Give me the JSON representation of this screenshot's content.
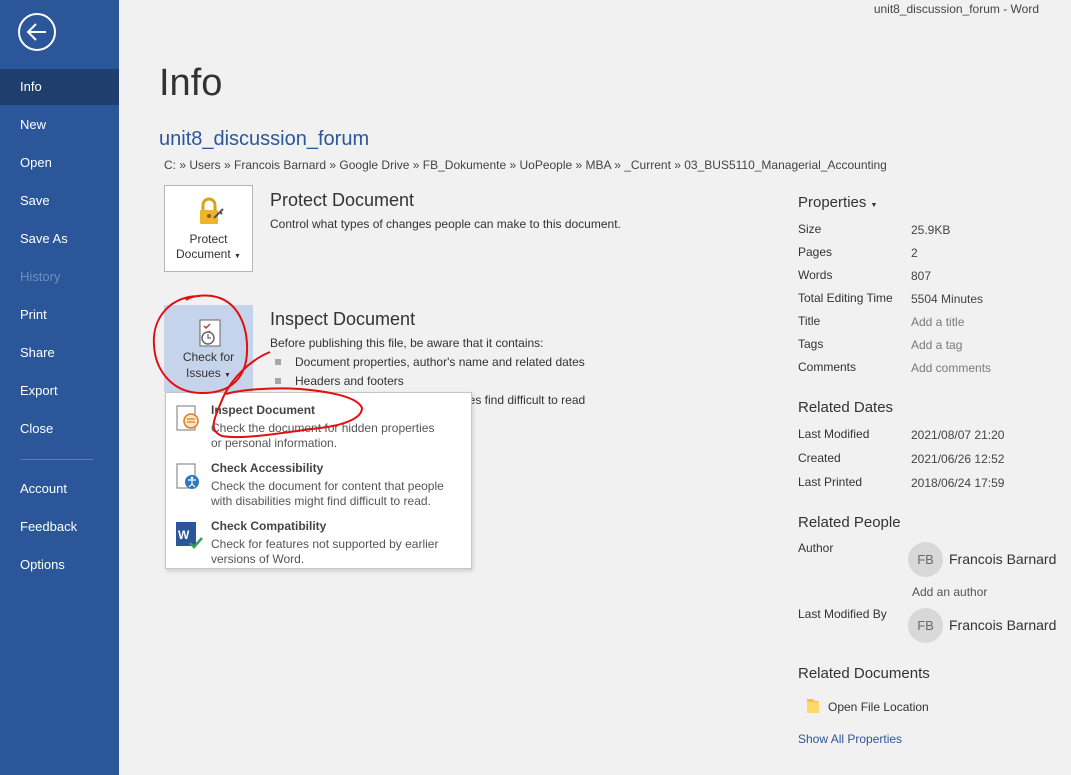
{
  "window": {
    "title": "unit8_discussion_forum  -  Word"
  },
  "sidebar": {
    "back_icon": "arrow-left-icon",
    "items": [
      {
        "label": "Info"
      },
      {
        "label": "New"
      },
      {
        "label": "Open"
      },
      {
        "label": "Save"
      },
      {
        "label": "Save As"
      },
      {
        "label": "History"
      },
      {
        "label": "Print"
      },
      {
        "label": "Share"
      },
      {
        "label": "Export"
      },
      {
        "label": "Close"
      },
      {
        "label": "Account"
      },
      {
        "label": "Feedback"
      },
      {
        "label": "Options"
      }
    ],
    "active_color": "#1e3f6e",
    "bg_color": "#2b579a"
  },
  "main": {
    "page_title": "Info",
    "document_name": "unit8_discussion_forum",
    "path": "C: » Users » Francois Barnard » Google Drive » FB_Dokumente » UoPeople » MBA » _Current » 03_BUS5110_Managerial_Accounting",
    "protect": {
      "button_line1": "Protect",
      "button_line2": "Document",
      "title": "Protect Document",
      "description": "Control what types of changes people can make to this document."
    },
    "inspect": {
      "button_line1": "Check for",
      "button_line2": "Issues",
      "title": "Inspect Document",
      "description": "Before publishing this file, be aware that it contains:",
      "bullets": [
        "Document properties, author's name and related dates",
        "Headers and footers",
        "ies find difficult to read"
      ]
    },
    "dropdown": [
      {
        "title": "Inspect Document",
        "description_line1": "Check the document for hidden properties",
        "description_line2": "or personal information."
      },
      {
        "title": "Check Accessibility",
        "description_line1": "Check the document for content that people",
        "description_line2": "with disabilities might find difficult to read."
      },
      {
        "title": "Check Compatibility",
        "description_line1": "Check for features not supported by earlier",
        "description_line2": "versions of Word."
      }
    ]
  },
  "properties": {
    "heading": "Properties",
    "rows": [
      {
        "label": "Size",
        "value": "25.9KB"
      },
      {
        "label": "Pages",
        "value": "2"
      },
      {
        "label": "Words",
        "value": "807"
      },
      {
        "label": "Total Editing Time",
        "value": "5504 Minutes"
      },
      {
        "label": "Title",
        "value": "Add a title"
      },
      {
        "label": "Tags",
        "value": "Add a tag"
      },
      {
        "label": "Comments",
        "value": "Add comments"
      }
    ],
    "related_dates": {
      "heading": "Related Dates",
      "rows": [
        {
          "label": "Last Modified",
          "value": "2021/08/07 21:20"
        },
        {
          "label": "Created",
          "value": "2021/06/26 12:52"
        },
        {
          "label": "Last Printed",
          "value": "2018/06/24 17:59"
        }
      ]
    },
    "related_people": {
      "heading": "Related People",
      "author_label": "Author",
      "author_initials": "FB",
      "author_name": "Francois Barnard",
      "add_author": "Add an author",
      "modified_label": "Last Modified By",
      "modified_initials": "FB",
      "modified_name": "Francois Barnard"
    },
    "related_documents": {
      "heading": "Related Documents",
      "open_location": "Open File Location",
      "show_all": "Show All Properties"
    }
  }
}
